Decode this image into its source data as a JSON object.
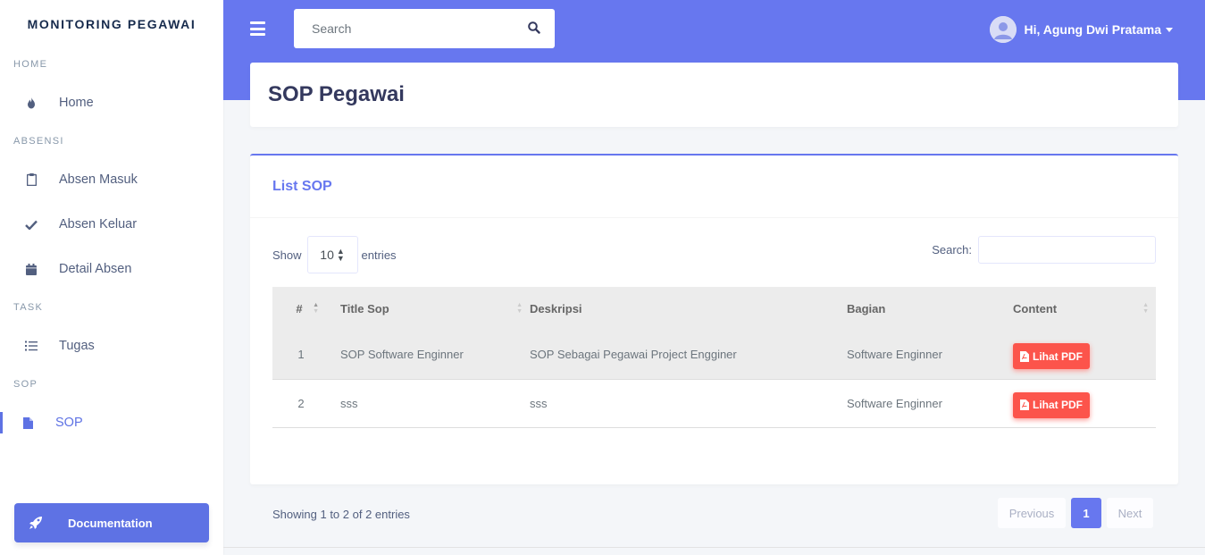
{
  "sidebar": {
    "brand": "MONITORING PEGAWAI",
    "sections": [
      {
        "title": "HOME",
        "items": [
          {
            "label": "Home",
            "icon": "fire-icon"
          }
        ]
      },
      {
        "title": "ABSENSI",
        "items": [
          {
            "label": "Absen Masuk",
            "icon": "clipboard-icon"
          },
          {
            "label": "Absen Keluar",
            "icon": "check-icon"
          },
          {
            "label": "Detail Absen",
            "icon": "calendar-icon"
          }
        ]
      },
      {
        "title": "TASK",
        "items": [
          {
            "label": "Tugas",
            "icon": "list-icon"
          }
        ]
      },
      {
        "title": "SOP",
        "items": [
          {
            "label": "SOP",
            "icon": "file-icon",
            "active": true
          }
        ]
      }
    ],
    "documentation_label": "Documentation"
  },
  "header": {
    "search_placeholder": "Search",
    "user_greeting": "Hi, Agung Dwi Pratama"
  },
  "page": {
    "title": "SOP Pegawai"
  },
  "card": {
    "title": "List SOP",
    "show_label": "Show",
    "entries_value": "10",
    "entries_label": "entries",
    "search_label": "Search:",
    "table": {
      "columns": [
        "#",
        "Title Sop",
        "Deskripsi",
        "Bagian",
        "Content"
      ],
      "rows": [
        {
          "no": "1",
          "title": "SOP Software Enginner",
          "deskripsi": "SOP Sebagai Pegawai Project Engginer",
          "bagian": "Software Enginner",
          "content": "Lihat PDF"
        },
        {
          "no": "2",
          "title": "sss",
          "deskripsi": "sss",
          "bagian": "Software Enginner",
          "content": "Lihat PDF"
        }
      ]
    },
    "info": "Showing 1 to 2 of 2 entries",
    "pagination": {
      "previous": "Previous",
      "current": "1",
      "next": "Next"
    }
  },
  "colors": {
    "primary": "#6777ef",
    "danger": "#fc544b",
    "background": "#f4f6f9"
  }
}
